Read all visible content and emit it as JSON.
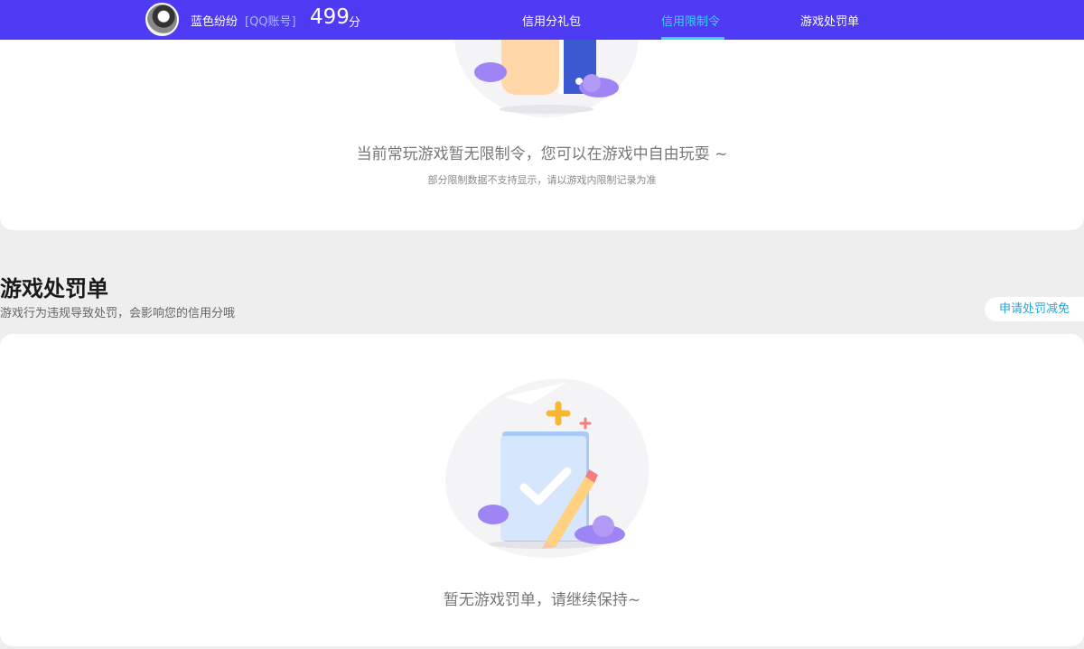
{
  "header": {
    "username": "蓝色纷纷",
    "account_type": "[QQ账号]",
    "score": "499",
    "score_unit": "分",
    "nav": [
      {
        "label": "信用分礼包",
        "active": false
      },
      {
        "label": "信用限制令",
        "active": true
      },
      {
        "label": "游戏处罚单",
        "active": false
      }
    ],
    "colors": {
      "bar": "#4f3bf4",
      "active": "#34d6f5"
    }
  },
  "restriction_card": {
    "message": "当前常玩游戏暂无限制令，您可以在游戏中自由玩耍 ~",
    "note": "部分限制数据不支持显示，请以游戏内限制记录为准"
  },
  "penalty_section": {
    "title": "游戏处罚单",
    "subtitle": "游戏行为违规导致处罚，会影响您的信用分哦",
    "appeal_button": "申请处罚减免",
    "empty_message": "暂无游戏罚单，请继续保持~"
  }
}
